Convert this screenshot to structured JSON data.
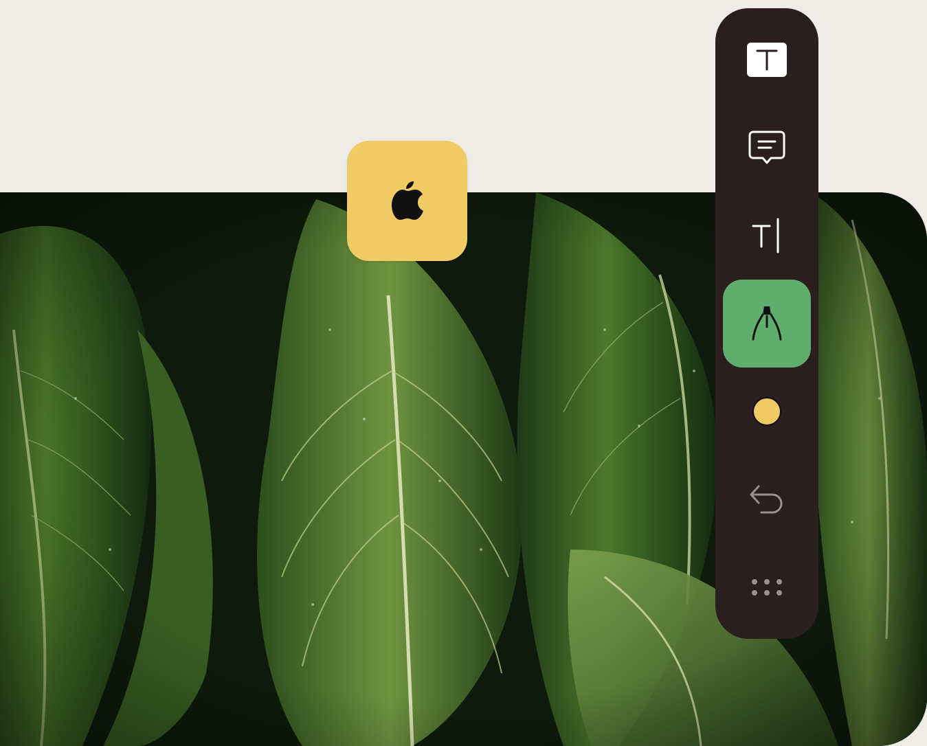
{
  "app_tile": {
    "icon": "apple-logo-icon",
    "color": "#f0ca63"
  },
  "toolbar": {
    "background": "#2a1e1f",
    "tools": [
      {
        "name": "text-box-tool",
        "icon": "text-box-icon",
        "active": false
      },
      {
        "name": "comment-tool",
        "icon": "chat-bubble-icon",
        "active": false
      },
      {
        "name": "text-cursor-tool",
        "icon": "text-cursor-icon",
        "active": false
      },
      {
        "name": "pen-tool",
        "icon": "pen-nib-icon",
        "active": true
      },
      {
        "name": "color-picker",
        "icon": "color-swatch-icon",
        "active": false,
        "color": "#f0ca63"
      },
      {
        "name": "undo",
        "icon": "undo-icon",
        "active": false
      },
      {
        "name": "more-options",
        "icon": "more-dots-icon",
        "active": false
      }
    ],
    "active_color": "#5fae6e"
  }
}
